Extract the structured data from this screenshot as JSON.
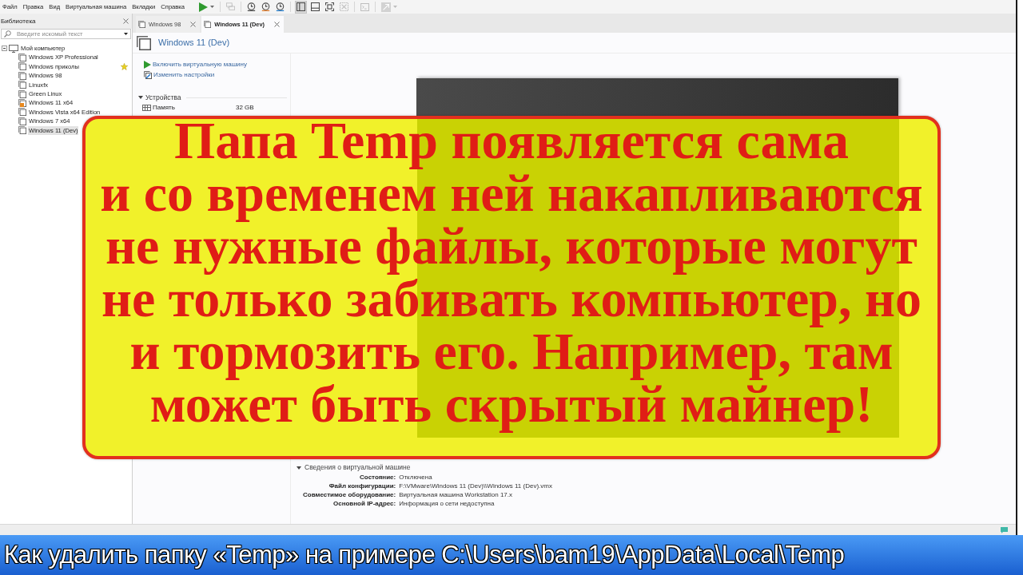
{
  "menu_bar": {
    "items": [
      "Файл",
      "Правка",
      "Вид",
      "Виртуальная машина",
      "Вкладки",
      "Справка"
    ]
  },
  "toolbar": {
    "groups": [
      {
        "buttons": [
          {
            "kind": "power",
            "disabled": false,
            "dropdown": true
          }
        ]
      },
      {
        "buttons": [
          {
            "kind": "network",
            "disabled": true
          }
        ]
      },
      {
        "buttons": [
          {
            "kind": "snapshot",
            "disabled": false
          },
          {
            "kind": "revert",
            "disabled": false
          },
          {
            "kind": "manager",
            "disabled": false
          }
        ]
      },
      {
        "buttons": [
          {
            "kind": "library",
            "disabled": false,
            "pressed": true
          },
          {
            "kind": "thumbnails",
            "disabled": false,
            "pressed": false
          },
          {
            "kind": "fullscreen",
            "disabled": false,
            "pressed": false
          },
          {
            "kind": "unity",
            "disabled": true,
            "pressed": false
          }
        ]
      },
      {
        "buttons": [
          {
            "kind": "console",
            "disabled": true
          }
        ]
      },
      {
        "buttons": [
          {
            "kind": "stretch",
            "disabled": true,
            "dropdown": true
          }
        ]
      }
    ]
  },
  "library": {
    "title": "Библиотека",
    "search": {
      "placeholder": "Введите искомый текст"
    },
    "tree": [
      {
        "label": "Мой компьютер",
        "selected": false,
        "expanded": true,
        "children": [
          {
            "label": "Windows XP Professional",
            "selected": false
          },
          {
            "label": "Windows приколы",
            "selected": false,
            "favorite": true
          },
          {
            "label": "Windows 98",
            "selected": false
          },
          {
            "label": "Linuxfx",
            "selected": false
          },
          {
            "label": "Green Linux",
            "selected": false
          },
          {
            "label": "Windows 11 x64",
            "selected": false,
            "locked": true
          },
          {
            "label": "Windows Vista x64 Edition",
            "selected": false
          },
          {
            "label": "Windows 7 x64",
            "selected": false
          },
          {
            "label": "Windows 11 (Dev)",
            "selected": true
          }
        ]
      }
    ]
  },
  "tabs": [
    {
      "label": "Windows 98",
      "selected": false
    },
    {
      "label": "Windows 11 (Dev)",
      "selected": true
    }
  ],
  "vm": {
    "title": "Windows 11 (Dev)",
    "actions": [
      {
        "kind": "power-on",
        "label": "Включить виртуальную машину"
      },
      {
        "kind": "settings",
        "label": "Изменить настройки"
      }
    ],
    "devices": {
      "title": "Устройства",
      "expanded": true,
      "rows": [
        {
          "kind": "memory",
          "name": "Память",
          "value": "32 GB"
        }
      ]
    },
    "details": {
      "title": "Сведения о виртуальной машине",
      "expanded": true,
      "rows": [
        {
          "label": "Состояние:",
          "value": "Отключена"
        },
        {
          "label": "Файл конфигурации:",
          "value": "F:\\VMware\\Windows 11 (Dev)\\\\Windows 11 (Dev).vmx"
        },
        {
          "label": "Совместимое оборудование:",
          "value": "Виртуальная машина Workstation 17.x"
        },
        {
          "label": "Основной IP-адрес:",
          "value": "Информация о сети недоступна"
        }
      ]
    }
  },
  "overlay": {
    "lines": [
      "Папа Temp появляется сама",
      "и со временем ней накапливаются",
      "не нужные файлы, которые могут",
      "не только забивать компьютер, но",
      "и тормозить его. Например, там",
      "может быть скрытый майнер!"
    ]
  },
  "banner": {
    "text": "Как удалить папку «Temp» на примере C:\\Users\\bam19\\AppData\\Local\\Temp"
  }
}
